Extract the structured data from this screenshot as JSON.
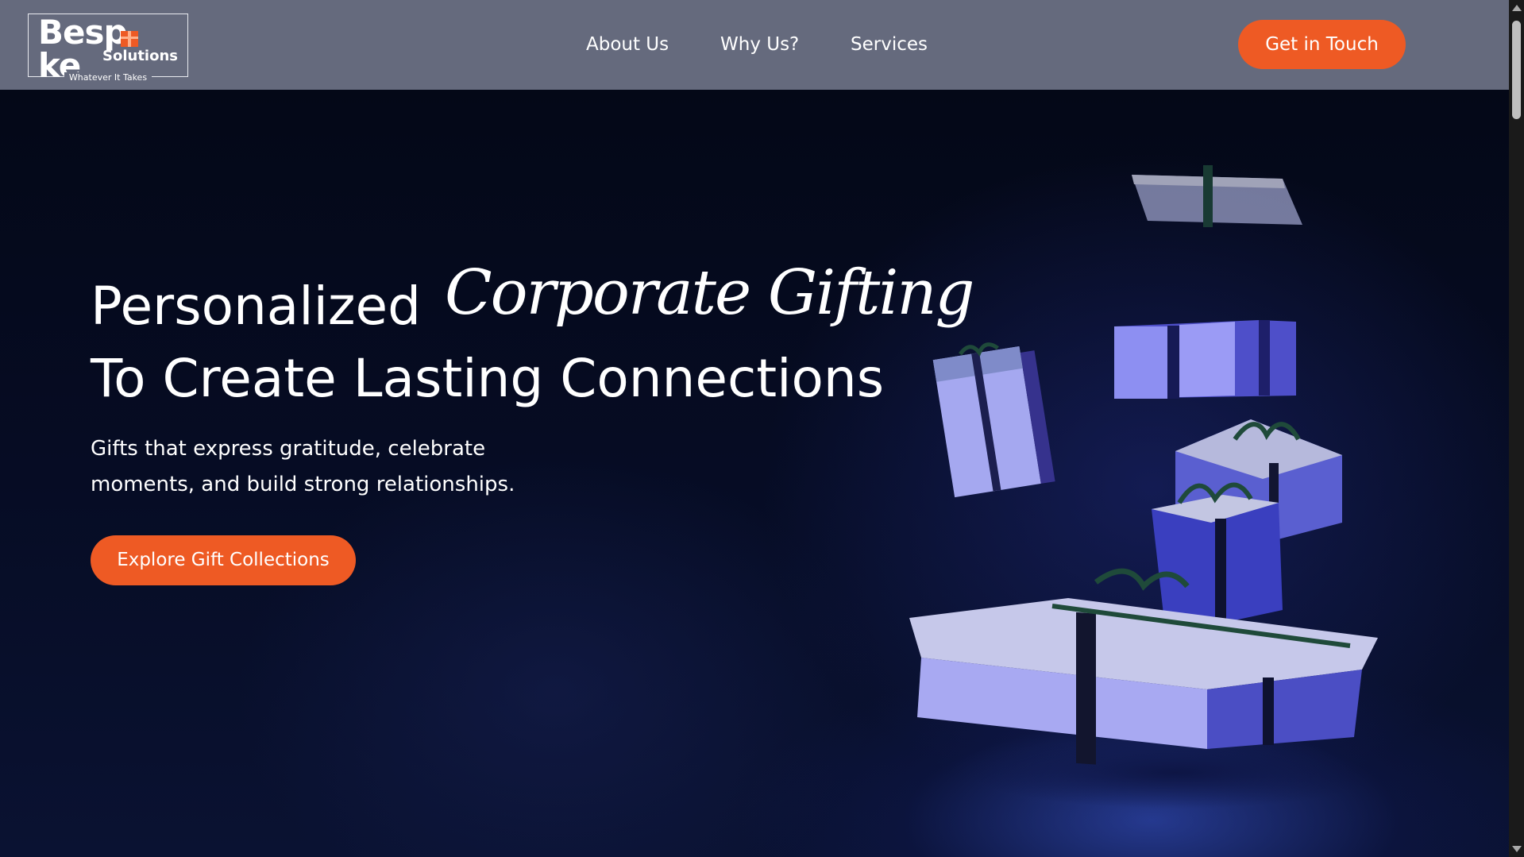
{
  "brand": {
    "name_part1": "Besp",
    "name_part2": "ke",
    "sub": "Solutions",
    "tagline": "Whatever It Takes",
    "accent_color": "#ee5a24"
  },
  "nav": {
    "items": [
      {
        "label": "About Us"
      },
      {
        "label": "Why Us?"
      },
      {
        "label": "Services"
      }
    ],
    "cta_label": "Get in Touch"
  },
  "hero": {
    "title_line1": "Personalized",
    "title_script": "Corporate Gifting",
    "title_line2": "To Create Lasting Connections",
    "subtitle": "Gifts that express gratitude, celebrate moments, and build strong relationships.",
    "cta_label": "Explore Gift Collections",
    "background_image": "floating-gift-boxes"
  },
  "icons": {
    "logo_gift": "gift-box-icon",
    "scroll_up": "chevron-up-icon",
    "scroll_down": "chevron-down-icon"
  }
}
